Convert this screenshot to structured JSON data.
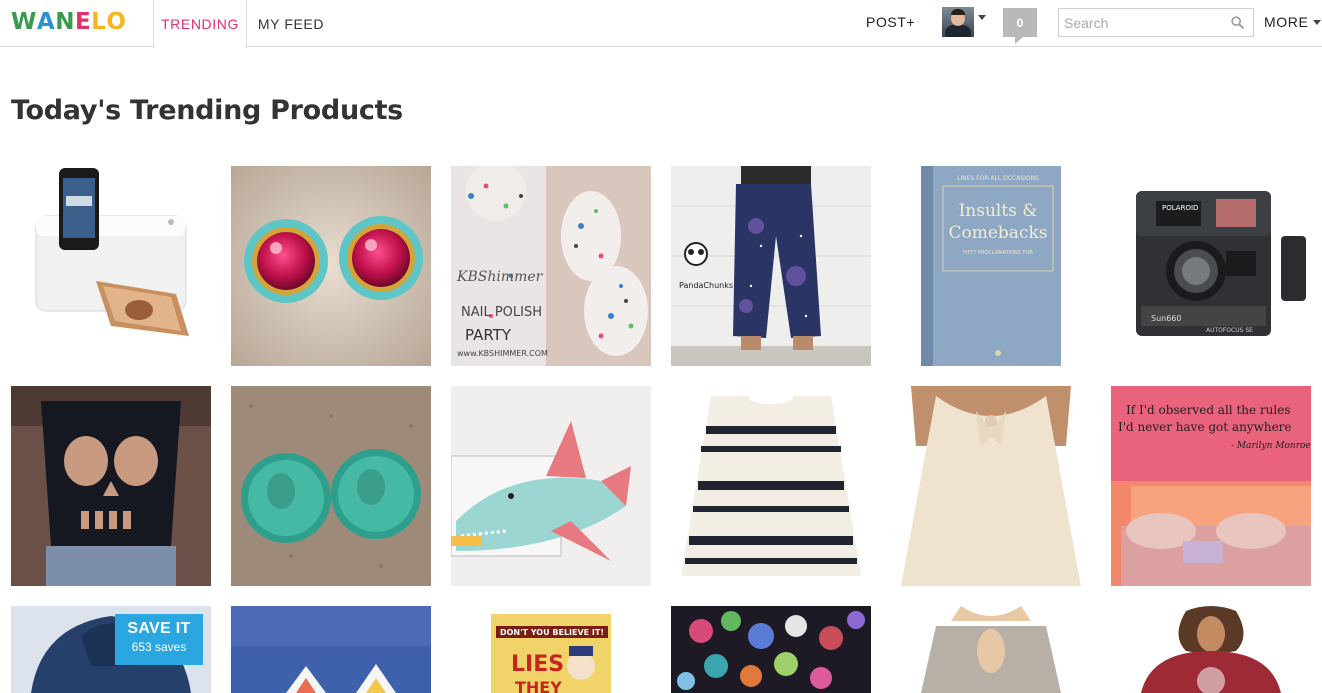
{
  "header": {
    "logo_letters": [
      {
        "char": "W",
        "color": "#3a9b4e"
      },
      {
        "char": "A",
        "color": "#2a93cf"
      },
      {
        "char": "N",
        "color": "#3a9b4e"
      },
      {
        "char": "E",
        "color": "#e0306f"
      },
      {
        "char": "L",
        "color": "#f5b51f"
      },
      {
        "char": "O",
        "color": "#f5b51f"
      }
    ],
    "tabs": [
      {
        "label": "TRENDING",
        "active": true
      },
      {
        "label": "MY FEED",
        "active": false
      }
    ],
    "post_label": "POST+",
    "notification_count": "0",
    "search": {
      "placeholder": "Search",
      "value": ""
    },
    "more_label": "MORE",
    "icons": {
      "search": "search-icon",
      "avatar": "user-avatar",
      "dropdown": "caret-down-icon"
    }
  },
  "page": {
    "title": "Today's Trending Products",
    "accent_color": "#e0306f"
  },
  "products": [
    {
      "name": "photo-printer-dock",
      "text": []
    },
    {
      "name": "pink-crystal-earrings",
      "text": []
    },
    {
      "name": "glitter-nail-polish",
      "text": [
        "KBShimmer",
        "NAIL POLISH",
        "PARTY",
        "www.KBSHIMMER.COM"
      ]
    },
    {
      "name": "galaxy-sweatpants",
      "text": [
        "PandaChunks"
      ]
    },
    {
      "name": "insults-comebacks-book",
      "text": [
        "LINES FOR ALL OCCASIONS",
        "Insults &",
        "Comebacks",
        "FIFTY PROCLAMATIONS FOR"
      ]
    },
    {
      "name": "polaroid-sun660-camera",
      "text": [
        "POLAROID",
        "Sun660",
        "AUTOFOCUS SE"
      ]
    },
    {
      "name": "skull-cutout-tank-top",
      "text": []
    },
    {
      "name": "penny-earrings",
      "text": []
    },
    {
      "name": "shark-pencil-case",
      "text": []
    },
    {
      "name": "striped-knit-sweater",
      "text": []
    },
    {
      "name": "bow-back-blouse",
      "text": []
    },
    {
      "name": "wall-quote-decal",
      "text": [
        "If I'd observed all the rules",
        "I'd never have got anywhere",
        "- Marilyn Monroe"
      ]
    },
    {
      "name": "blue-hoodie",
      "text": [],
      "save_badge": {
        "label": "SAVE IT",
        "count": "653 saves"
      }
    },
    {
      "name": "geometric-earrings",
      "text": []
    },
    {
      "name": "lies-book",
      "text": [
        "DON'T YOU BELIEVE IT!",
        "LIES",
        "THEY"
      ]
    },
    {
      "name": "string-lights",
      "text": []
    },
    {
      "name": "open-back-top",
      "text": []
    },
    {
      "name": "printed-sweater",
      "text": []
    }
  ]
}
